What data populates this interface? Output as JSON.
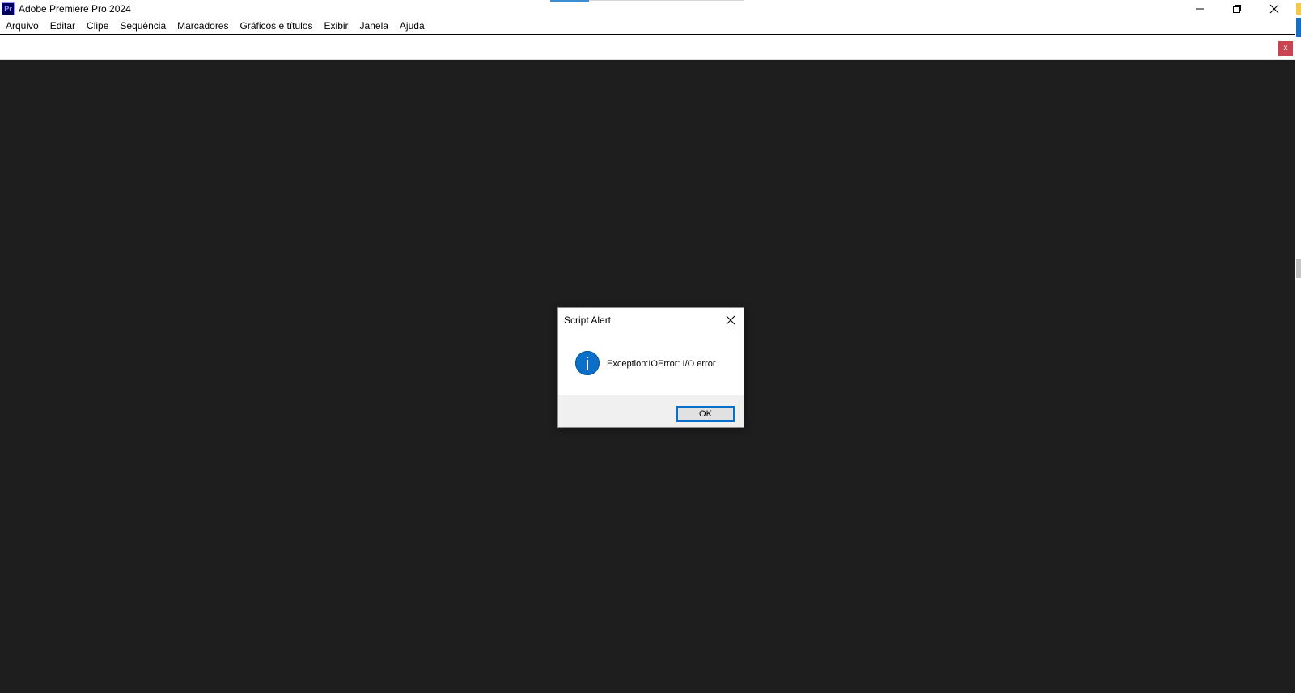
{
  "window": {
    "app_icon_text": "Pr",
    "title": "Adobe Premiere Pro 2024"
  },
  "menu": {
    "items": [
      "Arquivo",
      "Editar",
      "Clipe",
      "Sequência",
      "Marcadores",
      "Gráficos e títulos",
      "Exibir",
      "Janela",
      "Ajuda"
    ]
  },
  "strip": {
    "close_label": "x"
  },
  "dialog": {
    "title": "Script Alert",
    "message": "Exception:IOError: I/O error",
    "ok_label": "OK",
    "icon": "info-icon"
  },
  "colors": {
    "workspace_bg": "#1e1e1e",
    "accent_blue": "#0a6fc8",
    "strip_close_bg": "#c8454f"
  }
}
